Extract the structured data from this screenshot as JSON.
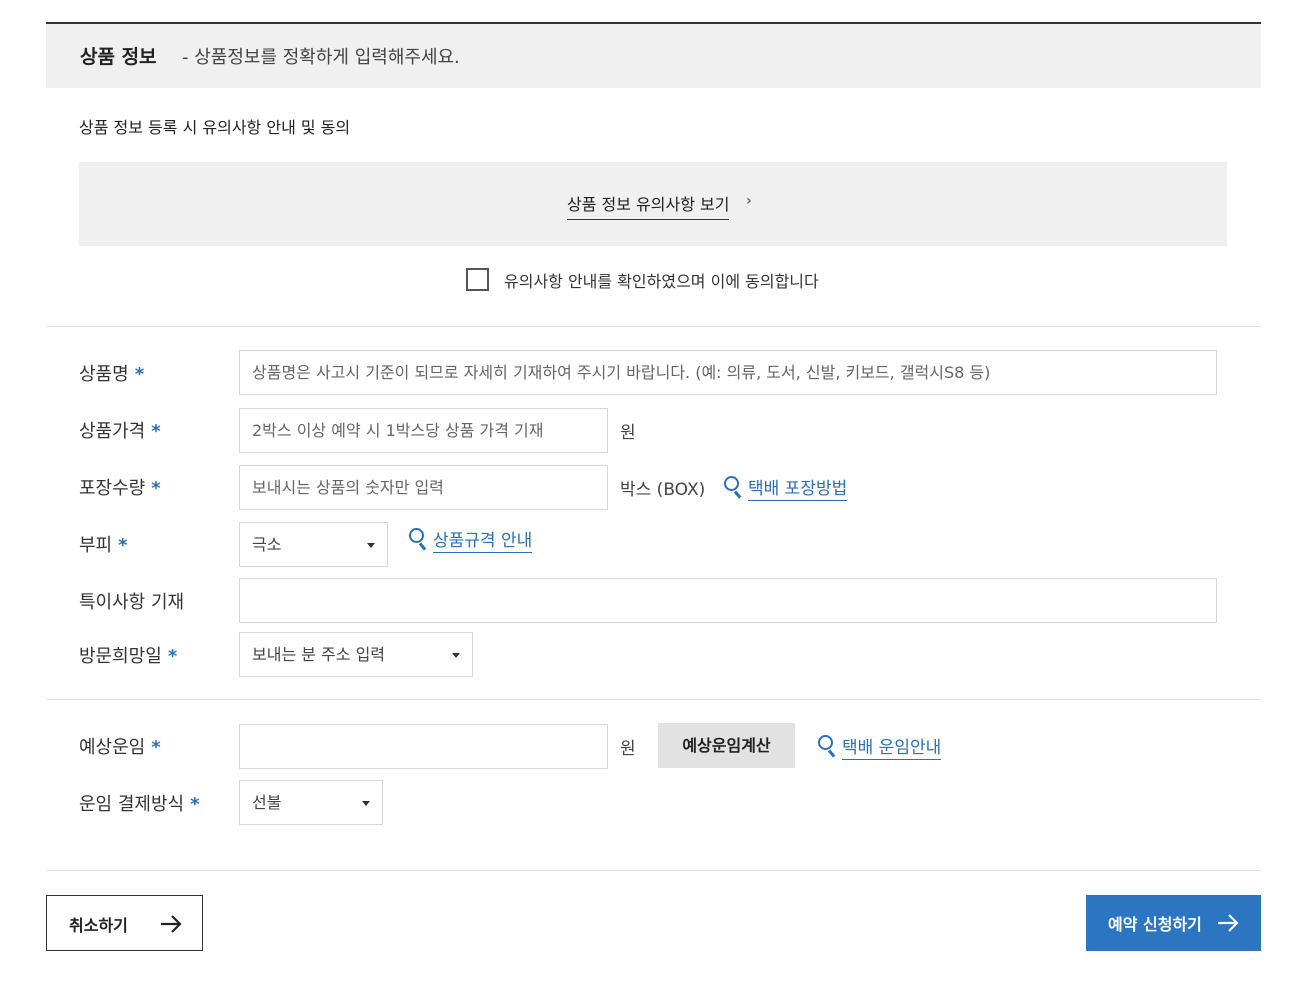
{
  "header": {
    "title": "상품 정보",
    "subtitle": "- 상품정보를 정확하게 입력해주세요."
  },
  "notice": {
    "heading": "상품 정보 등록 시 유의사항 안내 및 동의",
    "view_link": "상품 정보 유의사항 보기",
    "arrow": "›",
    "agree_label": "유의사항 안내를 확인하였으며 이에 동의합니다",
    "agree_checked": false
  },
  "product": {
    "name_label": "상품명",
    "name_placeholder": "상품명은 사고시 기준이 되므로 자세히 기재하여 주시기 바랍니다. (예: 의류, 도서, 신발, 키보드, 갤럭시S8 등)",
    "price_label": "상품가격",
    "price_placeholder": "2박스 이상 예약 시 1박스당 상품 가격 기재",
    "price_unit": "원",
    "qty_label": "포장수량",
    "qty_placeholder": "보내시는 상품의 숫자만 입력",
    "qty_unit": "박스 (BOX)",
    "packing_guide": "택배 포장방법",
    "volume_label": "부피",
    "volume_value": "극소",
    "spec_guide": "상품규격 안내",
    "notes_label": "특이사항 기재",
    "notes_value": "",
    "visit_label": "방문희망일",
    "visit_value": "보내는 분 주소 입력"
  },
  "fare": {
    "estimate_label": "예상운임",
    "estimate_value": "",
    "estimate_unit": "원",
    "calc_button": "예상운임계산",
    "fare_guide": "택배 운임안내",
    "payment_label": "운임 결제방식",
    "payment_value": "선불"
  },
  "required_mark": "*",
  "actions": {
    "cancel": "취소하기",
    "submit": "예약 신청하기"
  },
  "colors": {
    "accent": "#2b75c1",
    "link": "#2b6fba",
    "panel": "#f0f0f0"
  },
  "icons": {
    "guide": "magnifier-icon",
    "action": "arrow-right-icon"
  }
}
